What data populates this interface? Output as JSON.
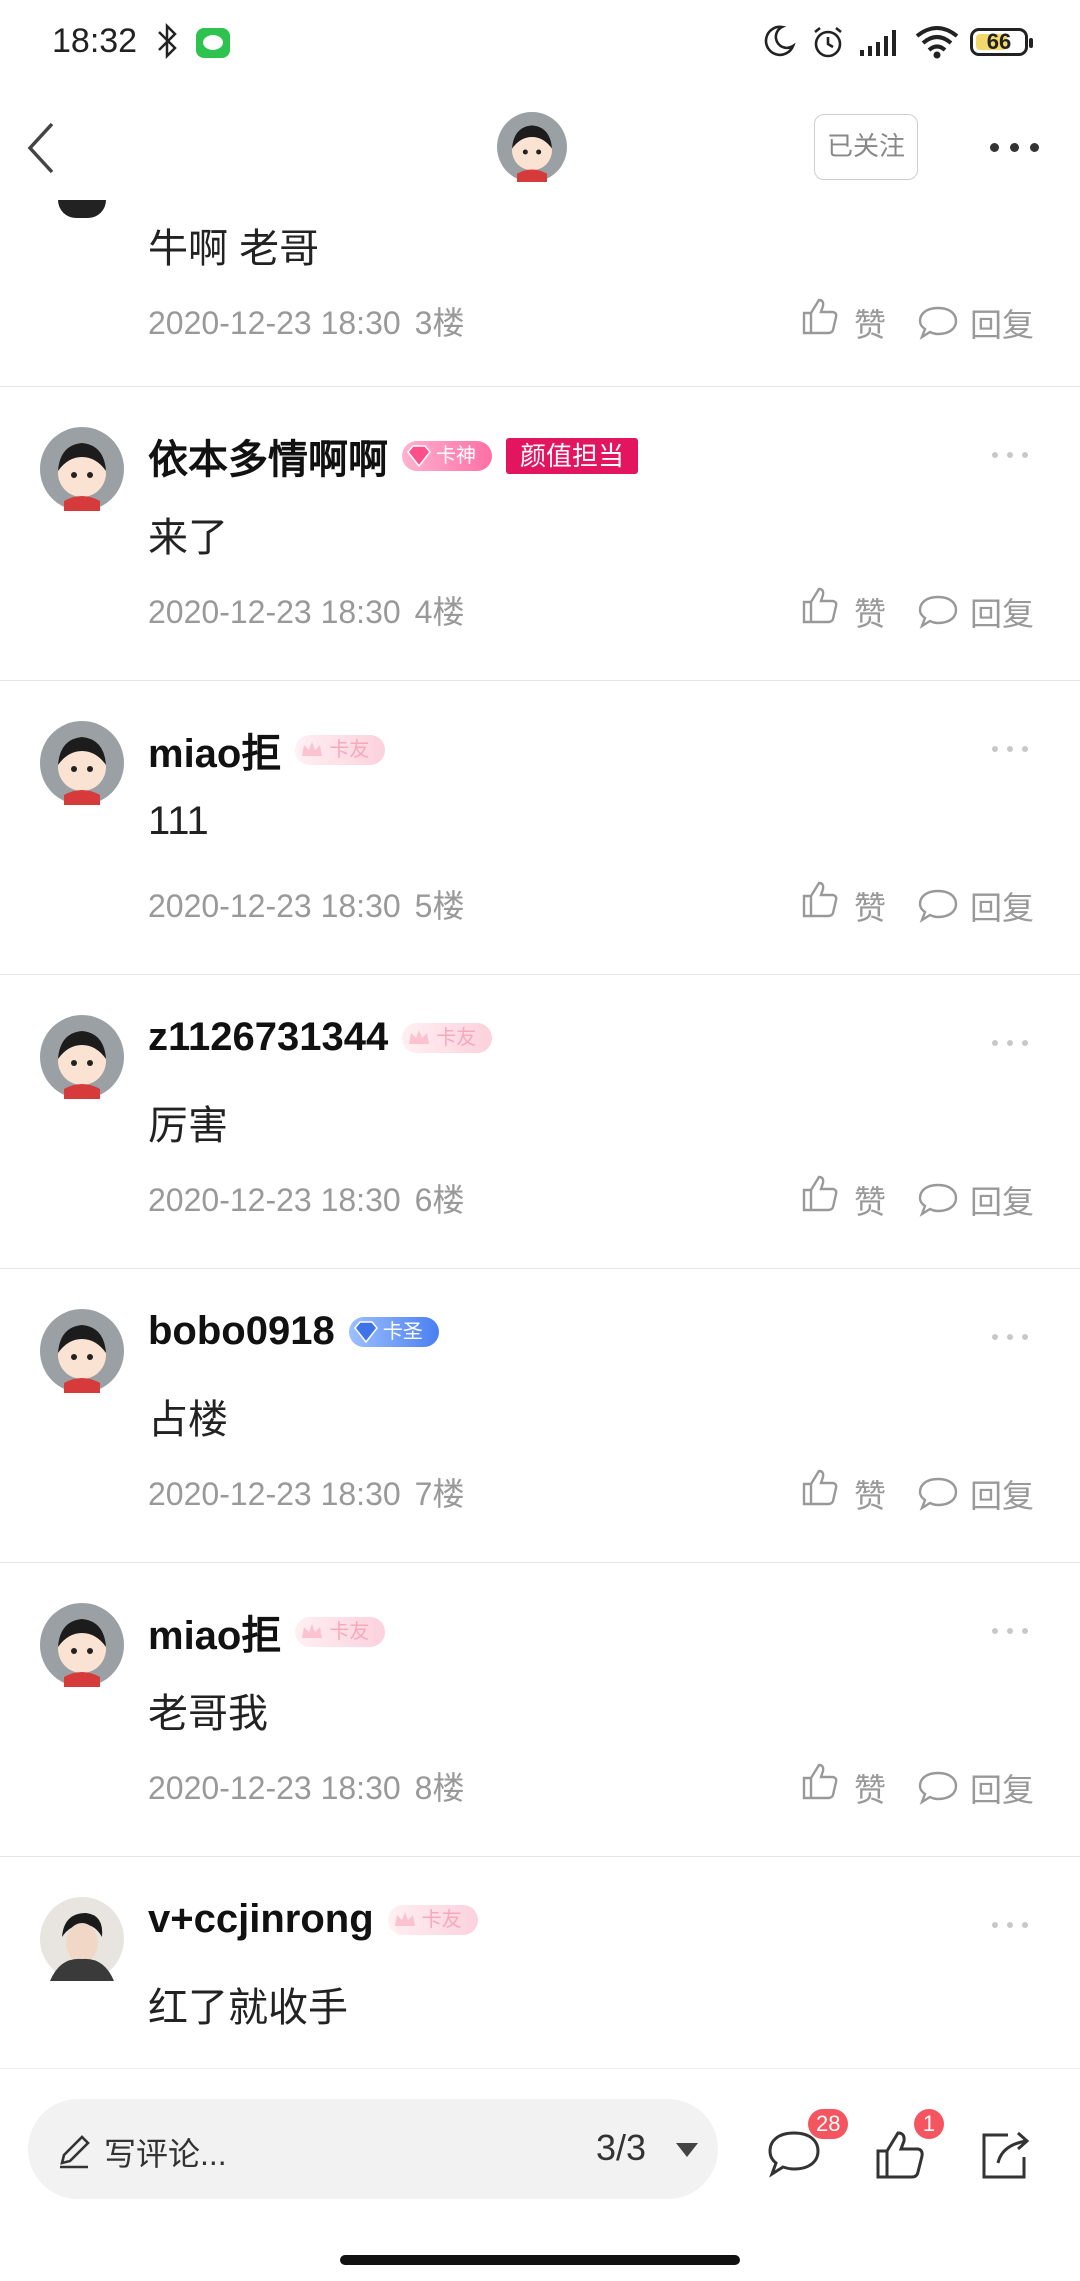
{
  "status_bar": {
    "time": "18:32",
    "battery": "66"
  },
  "nav": {
    "follow_label": "已关注"
  },
  "comments": [
    {
      "content": "牛啊  老哥",
      "date": "2020-12-23 18:30",
      "floor": "3楼",
      "like": "赞",
      "reply": "回复"
    },
    {
      "username": "依本多情啊啊",
      "badge": "卡神",
      "tag": "颜值担当",
      "content": "来了",
      "date": "2020-12-23 18:30",
      "floor": "4楼",
      "like": "赞",
      "reply": "回复"
    },
    {
      "username": "miao拒",
      "badge": "卡友",
      "content": "111",
      "date": "2020-12-23 18:30",
      "floor": "5楼",
      "like": "赞",
      "reply": "回复"
    },
    {
      "username": "z1126731344",
      "badge": "卡友",
      "content": "厉害",
      "date": "2020-12-23 18:30",
      "floor": "6楼",
      "like": "赞",
      "reply": "回复"
    },
    {
      "username": "bobo0918",
      "badge": "卡圣",
      "content": "占楼",
      "date": "2020-12-23 18:30",
      "floor": "7楼",
      "like": "赞",
      "reply": "回复"
    },
    {
      "username": "miao拒",
      "badge": "卡友",
      "content": "老哥我",
      "date": "2020-12-23 18:30",
      "floor": "8楼",
      "like": "赞",
      "reply": "回复"
    },
    {
      "username": "v+ccjinrong",
      "badge": "卡友",
      "content": "红了就收手"
    }
  ],
  "bottom_bar": {
    "placeholder": "写评论...",
    "pager": "3/3",
    "comment_count": "28",
    "like_count": "1"
  },
  "colors": {
    "tag_red": "#e3155e",
    "badge_red": "#f4555f"
  }
}
